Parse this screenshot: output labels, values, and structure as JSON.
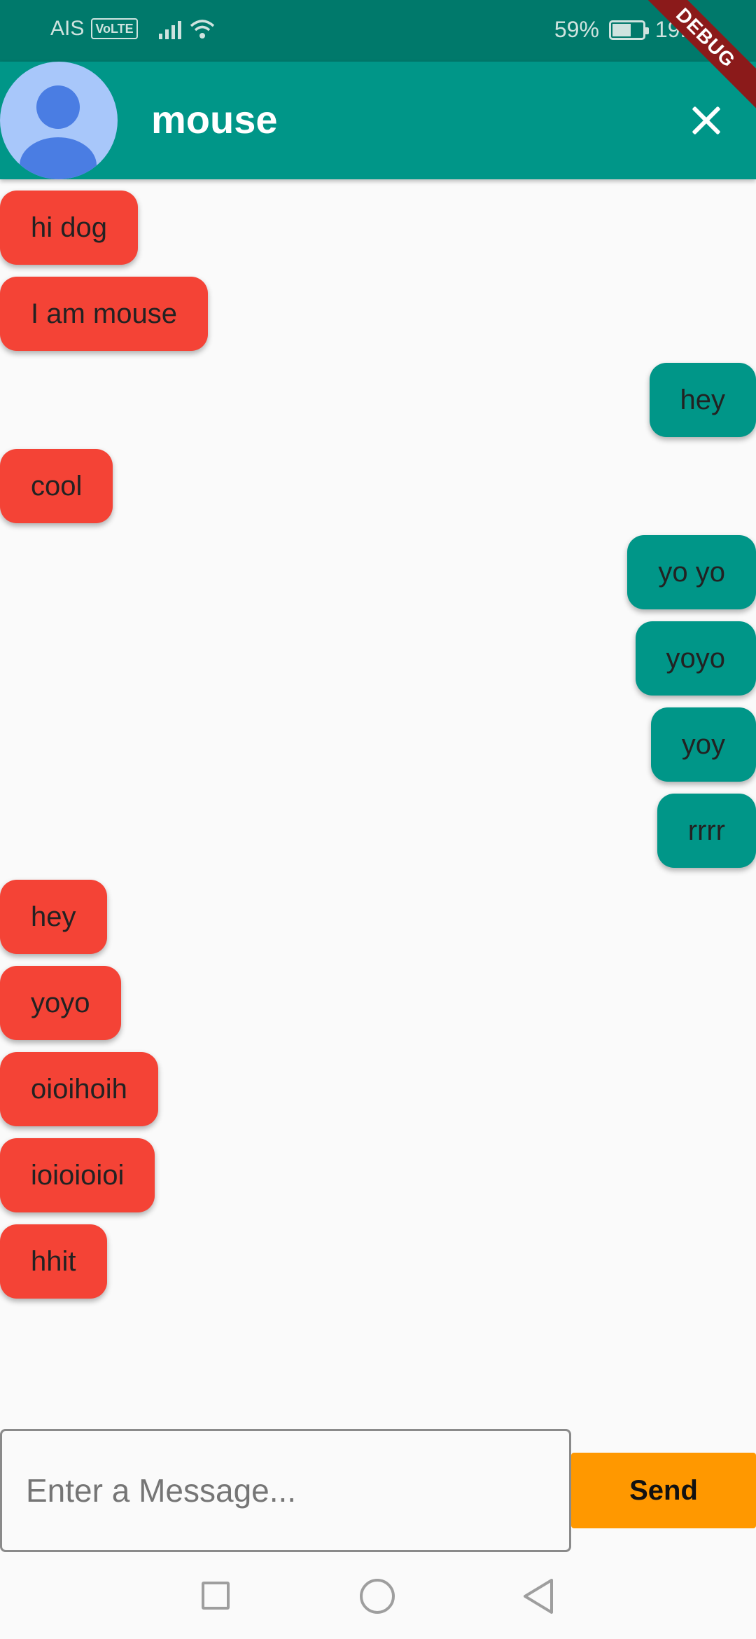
{
  "status_bar": {
    "carrier": "AIS",
    "volte": "VoLTE",
    "battery": "59%",
    "time": "19:04",
    "battery_level": 0.59
  },
  "debug_banner": "DEBUG",
  "header": {
    "title": "mouse",
    "avatar_icon": "person-avatar-icon",
    "close_icon": "close-icon"
  },
  "messages": [
    {
      "text": "hi dog",
      "side": "left"
    },
    {
      "text": "I am mouse",
      "side": "left"
    },
    {
      "text": "hey",
      "side": "right"
    },
    {
      "text": "cool",
      "side": "left"
    },
    {
      "text": "yo yo",
      "side": "right"
    },
    {
      "text": "yoyo",
      "side": "right"
    },
    {
      "text": "yoy",
      "side": "right"
    },
    {
      "text": "rrrr",
      "side": "right"
    },
    {
      "text": "hey",
      "side": "left"
    },
    {
      "text": "yoyo",
      "side": "left"
    },
    {
      "text": "oioihoih",
      "side": "left"
    },
    {
      "text": "ioioioioi",
      "side": "left"
    },
    {
      "text": "hhit",
      "side": "left"
    }
  ],
  "composer": {
    "placeholder": "Enter a Message...",
    "send_label": "Send"
  },
  "colors": {
    "status_bar": "#00796b",
    "app_bar": "#009688",
    "incoming_bubble": "#f44336",
    "outgoing_bubble": "#009688",
    "send_button": "#ff9800"
  }
}
